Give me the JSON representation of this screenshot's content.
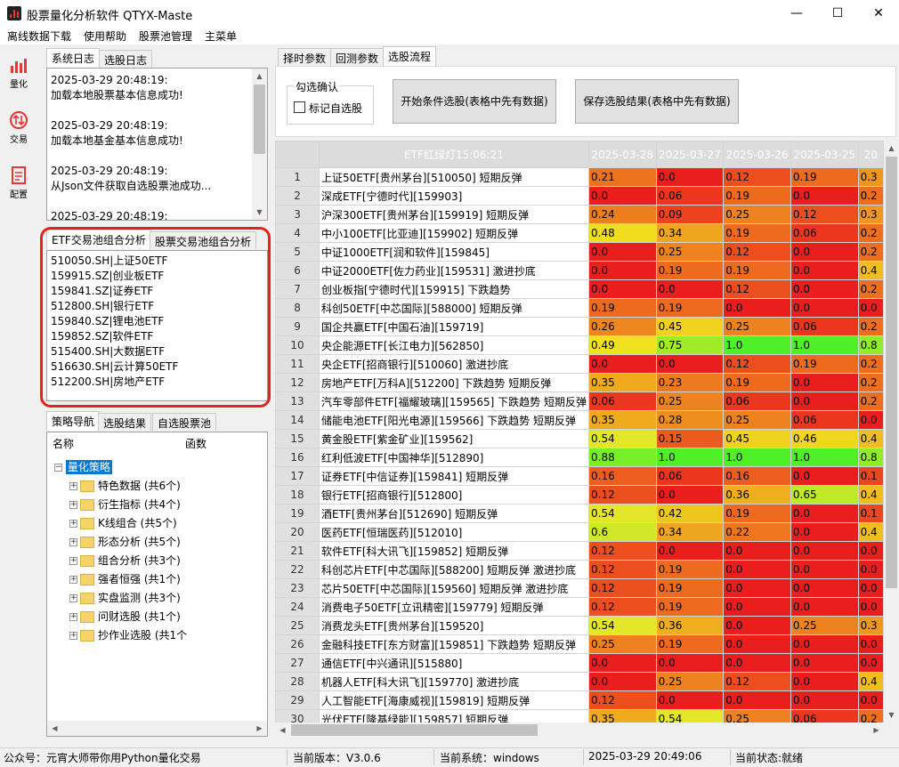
{
  "window": {
    "title": "股票量化分析软件 QTYX-Maste",
    "minimize": "—",
    "maximize": "☐",
    "close": "✕"
  },
  "menu": [
    "离线数据下载",
    "使用帮助",
    "股票池管理",
    "主菜单"
  ],
  "toolbar": [
    {
      "label": "量化",
      "icon": "bar-chart-icon"
    },
    {
      "label": "交易",
      "icon": "trade-arrows-icon"
    },
    {
      "label": "配置",
      "icon": "document-icon"
    }
  ],
  "log_tabs": [
    "系统日志",
    "选股日志"
  ],
  "log_entries": [
    {
      "time": "2025-03-29 20:48:19:",
      "msg": "加载本地股票基本信息成功!"
    },
    {
      "time": "2025-03-29 20:48:19:",
      "msg": "加载本地基金基本信息成功!"
    },
    {
      "time": "2025-03-29 20:48:19:",
      "msg": "从Json文件获取自选股票池成功..."
    },
    {
      "time": "2025-03-29 20:48:19:",
      "msg": ""
    }
  ],
  "pool_tabs": [
    "ETF交易池组合分析",
    "股票交易池组合分析"
  ],
  "etf_list": [
    "510050.SH|上证50ETF",
    "159915.SZ|创业板ETF",
    "159841.SZ|证券ETF",
    "512800.SH|银行ETF",
    "159840.SZ|锂电池ETF",
    "159852.SZ|软件ETF",
    "515400.SH|大数据ETF",
    "516630.SH|云计算50ETF",
    "512200.SH|房地产ETF"
  ],
  "nav_tabs": [
    "策略导航",
    "选股结果",
    "自选股票池"
  ],
  "tree": {
    "col_name": "名称",
    "col_func": "函数",
    "root": "量化策略",
    "children": [
      "特色数据 (共6个)",
      "衍生指标 (共4个)",
      "K线组合 (共5个)",
      "形态分析 (共5个)",
      "组合分析 (共3个)",
      "强者恒强 (共1个)",
      "实盘监测 (共3个)",
      "问财选股 (共1个)",
      "抄作业选股 (共1个"
    ]
  },
  "right_tabs": [
    "择时参数",
    "回测参数",
    "选股流程"
  ],
  "select_group": {
    "title": "勾选确认",
    "checkbox": "标记自选股"
  },
  "buttons": {
    "start": "开始条件选股(表格中先有数据)",
    "save": "保存选股结果(表格中先有数据)"
  },
  "table": {
    "header_name": "ETF红绿灯15:06:21",
    "dates": [
      "2025-03-28",
      "2025-03-27",
      "2025-03-26",
      "2025-03-25",
      "20"
    ],
    "rows": [
      {
        "n": "1",
        "name": "上证50ETF[贵州茅台][510050] 短期反弹",
        "v": [
          "0.21",
          "0.0",
          "0.12",
          "0.19",
          "0.3"
        ]
      },
      {
        "n": "2",
        "name": "深成ETF[宁德时代][159903]",
        "v": [
          "0.0",
          "0.06",
          "0.19",
          "0.0",
          "0.2"
        ]
      },
      {
        "n": "3",
        "name": "沪深300ETF[贵州茅台][159919] 短期反弹",
        "v": [
          "0.24",
          "0.09",
          "0.25",
          "0.12",
          "0.3"
        ]
      },
      {
        "n": "4",
        "name": "中小100ETF[比亚迪][159902] 短期反弹",
        "v": [
          "0.48",
          "0.34",
          "0.19",
          "0.06",
          "0.2"
        ]
      },
      {
        "n": "5",
        "name": "中证1000ETF[润和软件][159845]",
        "v": [
          "0.0",
          "0.25",
          "0.12",
          "0.0",
          "0.2"
        ]
      },
      {
        "n": "6",
        "name": "中证2000ETF[佐力药业][159531] 激进抄底",
        "v": [
          "0.0",
          "0.19",
          "0.19",
          "0.0",
          "0.4"
        ]
      },
      {
        "n": "7",
        "name": "创业板指[宁德时代][159915] 下跌趋势",
        "v": [
          "0.0",
          "0.0",
          "0.12",
          "0.0",
          "0.2"
        ]
      },
      {
        "n": "8",
        "name": "科创50ETF[中芯国际][588000] 短期反弹",
        "v": [
          "0.19",
          "0.19",
          "0.0",
          "0.0",
          "0.0"
        ]
      },
      {
        "n": "9",
        "name": "国企共赢ETF[中国石油][159719]",
        "v": [
          "0.26",
          "0.45",
          "0.25",
          "0.06",
          "0.2"
        ]
      },
      {
        "n": "10",
        "name": "央企能源ETF[长江电力][562850]",
        "v": [
          "0.49",
          "0.75",
          "1.0",
          "1.0",
          "0.8"
        ]
      },
      {
        "n": "11",
        "name": "央企ETF[招商银行][510060] 激进抄底",
        "v": [
          "0.0",
          "0.0",
          "0.12",
          "0.19",
          "0.2"
        ]
      },
      {
        "n": "12",
        "name": "房地产ETF[万科A][512200] 下跌趋势 短期反弹",
        "v": [
          "0.35",
          "0.23",
          "0.19",
          "0.0",
          "0.2"
        ]
      },
      {
        "n": "13",
        "name": "汽车零部件ETF[福耀玻璃][159565] 下跌趋势 短期反弹",
        "v": [
          "0.06",
          "0.25",
          "0.06",
          "0.0",
          "0.2"
        ]
      },
      {
        "n": "14",
        "name": "储能电池ETF[阳光电源][159566] 下跌趋势 短期反弹",
        "v": [
          "0.35",
          "0.28",
          "0.25",
          "0.06",
          "0.0"
        ]
      },
      {
        "n": "15",
        "name": "黄金股ETF[紫金矿业][159562]",
        "v": [
          "0.54",
          "0.15",
          "0.45",
          "0.46",
          "0.4"
        ]
      },
      {
        "n": "16",
        "name": "红利低波ETF[中国神华][512890]",
        "v": [
          "0.88",
          "1.0",
          "1.0",
          "1.0",
          "0.8"
        ]
      },
      {
        "n": "17",
        "name": "证券ETF[中信证券][159841] 短期反弹",
        "v": [
          "0.16",
          "0.06",
          "0.16",
          "0.0",
          "0.1"
        ]
      },
      {
        "n": "18",
        "name": "银行ETF[招商银行][512800]",
        "v": [
          "0.12",
          "0.0",
          "0.36",
          "0.65",
          "0.4"
        ]
      },
      {
        "n": "19",
        "name": "酒ETF[贵州茅台][512690] 短期反弹",
        "v": [
          "0.54",
          "0.42",
          "0.19",
          "0.0",
          "0.1"
        ]
      },
      {
        "n": "20",
        "name": "医药ETF[恒瑞医药][512010]",
        "v": [
          "0.6",
          "0.34",
          "0.22",
          "0.0",
          "0.4"
        ]
      },
      {
        "n": "21",
        "name": "软件ETF[科大讯飞][159852] 短期反弹",
        "v": [
          "0.12",
          "0.0",
          "0.0",
          "0.0",
          "0.0"
        ]
      },
      {
        "n": "22",
        "name": "科创芯片ETF[中芯国际][588200] 短期反弹 激进抄底",
        "v": [
          "0.12",
          "0.19",
          "0.0",
          "0.0",
          "0.0"
        ]
      },
      {
        "n": "23",
        "name": "芯片50ETF[中芯国际][159560] 短期反弹 激进抄底",
        "v": [
          "0.12",
          "0.19",
          "0.0",
          "0.0",
          "0.0"
        ]
      },
      {
        "n": "24",
        "name": "消费电子50ETF[立讯精密][159779] 短期反弹",
        "v": [
          "0.12",
          "0.19",
          "0.0",
          "0.0",
          "0.0"
        ]
      },
      {
        "n": "25",
        "name": "消费龙头ETF[贵州茅台][159520]",
        "v": [
          "0.54",
          "0.36",
          "0.0",
          "0.25",
          "0.3"
        ]
      },
      {
        "n": "26",
        "name": "金融科技ETF[东方财富][159851] 下跌趋势 短期反弹",
        "v": [
          "0.25",
          "0.19",
          "0.0",
          "0.0",
          "0.0"
        ]
      },
      {
        "n": "27",
        "name": "通信ETF[中兴通讯][515880]",
        "v": [
          "0.0",
          "0.0",
          "0.0",
          "0.0",
          "0.0"
        ]
      },
      {
        "n": "28",
        "name": "机器人ETF[科大讯飞][159770] 激进抄底",
        "v": [
          "0.0",
          "0.25",
          "0.12",
          "0.0",
          "0.4"
        ]
      },
      {
        "n": "29",
        "name": "人工智能ETF[海康威视][159819] 短期反弹",
        "v": [
          "0.12",
          "0.0",
          "0.0",
          "0.0",
          "0.0"
        ]
      },
      {
        "n": "30",
        "name": "光伏ETF[隆基绿能][159857] 短期反弹",
        "v": [
          "0.35",
          "0.54",
          "0.25",
          "0.06",
          "0.2"
        ]
      }
    ]
  },
  "status": {
    "account": "公众号：元宵大师带你用Python量化交易",
    "version": "当前版本：V3.0.6",
    "system": "当前系统：windows",
    "datetime": "2025-03-29 20:49:06",
    "state": "当前状态:就绪"
  },
  "colors": {
    "accent": "#0078d7",
    "highlight_border": "#e3231e",
    "header_bg": "#dcdcdc"
  }
}
